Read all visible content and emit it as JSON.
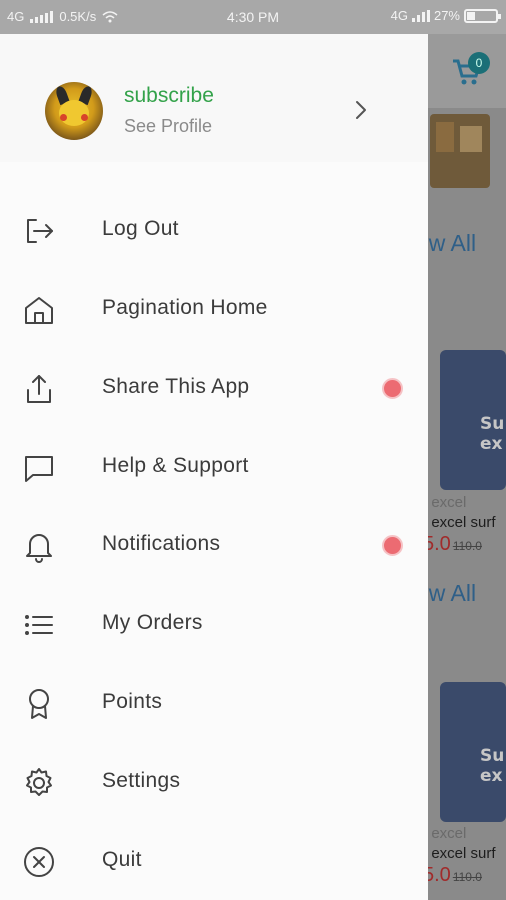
{
  "status_bar": {
    "network": "4G",
    "speed": "0.5K/s",
    "time": "4:30 PM",
    "network_right": "4G",
    "battery": "27%",
    "battery_level": 0.27
  },
  "drawer": {
    "profile": {
      "name": "subscribe",
      "subtitle": "See Profile"
    },
    "items": [
      {
        "label": "Log Out",
        "icon": "logout-icon",
        "dot": false
      },
      {
        "label": "Pagination Home",
        "icon": "home-icon",
        "dot": false
      },
      {
        "label": "Share This App",
        "icon": "share-icon",
        "dot": true
      },
      {
        "label": "Help & Support",
        "icon": "chat-icon",
        "dot": false
      },
      {
        "label": "Notifications",
        "icon": "bell-icon",
        "dot": true
      },
      {
        "label": "My Orders",
        "icon": "list-icon",
        "dot": false
      },
      {
        "label": "Points",
        "icon": "award-icon",
        "dot": false
      },
      {
        "label": "Settings",
        "icon": "gear-icon",
        "dot": false
      },
      {
        "label": "Quit",
        "icon": "close-circle-icon",
        "dot": false
      }
    ],
    "accent_color": "#33a24a",
    "dot_color": "#ec6b72"
  },
  "background_app": {
    "cart_count": "0",
    "view_all_1": "ew All",
    "view_all_2": "ew All",
    "products": [
      {
        "line1": "f excel",
        "line2": "f excel surf",
        "price": "5.0",
        "old_price": "110.0"
      },
      {
        "line1": "f excel",
        "line2": "f excel surf",
        "price": "5.0",
        "old_price": "110.0"
      }
    ]
  }
}
